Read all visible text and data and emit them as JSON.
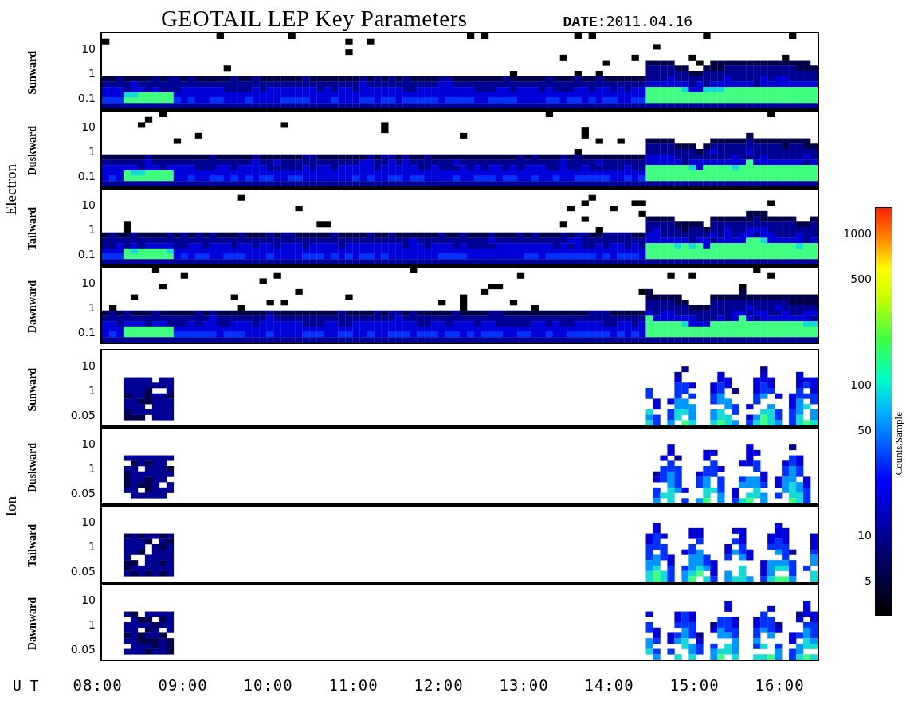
{
  "title": "GEOTAIL LEP Key Parameters",
  "date_label": "DATE:",
  "date": "2011.04.16",
  "groups": [
    {
      "name": "Electron",
      "kind": "electron",
      "panels": [
        {
          "label": "Sunward",
          "yticks": [
            "10",
            "1",
            "0.1"
          ]
        },
        {
          "label": "Duskward",
          "yticks": [
            "10",
            "1",
            "0.1"
          ]
        },
        {
          "label": "Tailward",
          "yticks": [
            "10",
            "1",
            "0.1"
          ]
        },
        {
          "label": "Dawnward",
          "yticks": [
            "10",
            "1",
            "0.1"
          ]
        }
      ]
    },
    {
      "name": "Ion",
      "kind": "ion",
      "panels": [
        {
          "label": "Sunward",
          "yticks": [
            "10",
            "1",
            "0.05"
          ]
        },
        {
          "label": "Duskward",
          "yticks": [
            "10",
            "1",
            "0.05"
          ]
        },
        {
          "label": "Tailward",
          "yticks": [
            "10",
            "1",
            "0.05"
          ]
        },
        {
          "label": "Dawnward",
          "yticks": [
            "10",
            "1",
            "0.05"
          ]
        }
      ]
    }
  ],
  "x_axis": {
    "label": "U T",
    "ticks": [
      "08:00",
      "09:00",
      "10:00",
      "11:00",
      "12:00",
      "13:00",
      "14:00",
      "15:00",
      "16:00"
    ]
  },
  "colorbar": {
    "label": "Counts/Sample",
    "ticks": [
      "1000",
      "500",
      "100",
      "50",
      "10",
      "5"
    ]
  }
}
